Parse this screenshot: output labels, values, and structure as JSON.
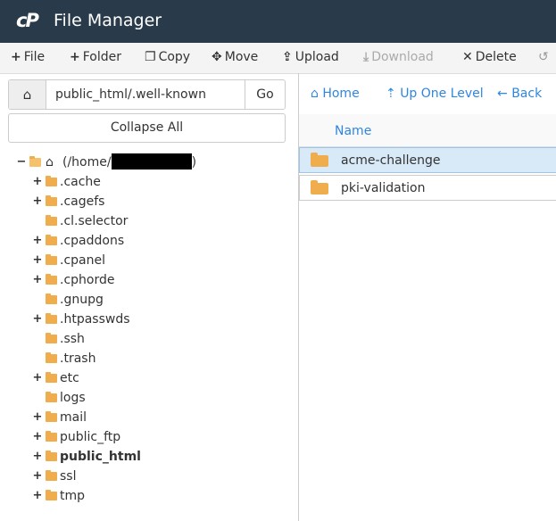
{
  "app": {
    "logo": "cP",
    "title": "File Manager"
  },
  "toolbar": {
    "file": "File",
    "folder": "Folder",
    "copy": "Copy",
    "move": "Move",
    "upload": "Upload",
    "download": "Download",
    "delete": "Delete"
  },
  "path": {
    "value": "public_html/.well-known",
    "go": "Go"
  },
  "collapse_all": "Collapse All",
  "tree": {
    "root_prefix": "(/home/",
    "root_suffix": ")",
    "items": [
      {
        "label": ".cache",
        "toggle": "+"
      },
      {
        "label": ".cagefs",
        "toggle": "+"
      },
      {
        "label": ".cl.selector",
        "toggle": ""
      },
      {
        "label": ".cpaddons",
        "toggle": "+"
      },
      {
        "label": ".cpanel",
        "toggle": "+"
      },
      {
        "label": ".cphorde",
        "toggle": "+"
      },
      {
        "label": ".gnupg",
        "toggle": ""
      },
      {
        "label": ".htpasswds",
        "toggle": "+"
      },
      {
        "label": ".ssh",
        "toggle": ""
      },
      {
        "label": ".trash",
        "toggle": ""
      },
      {
        "label": "etc",
        "toggle": "+"
      },
      {
        "label": "logs",
        "toggle": ""
      },
      {
        "label": "mail",
        "toggle": "+"
      },
      {
        "label": "public_ftp",
        "toggle": "+"
      },
      {
        "label": "public_html",
        "toggle": "+"
      },
      {
        "label": "ssl",
        "toggle": "+"
      },
      {
        "label": "tmp",
        "toggle": "+"
      }
    ]
  },
  "nav": {
    "home": "Home",
    "up": "Up One Level",
    "back": "Back"
  },
  "list": {
    "name_header": "Name",
    "files": [
      {
        "name": "acme-challenge"
      },
      {
        "name": "pki-validation"
      }
    ]
  }
}
